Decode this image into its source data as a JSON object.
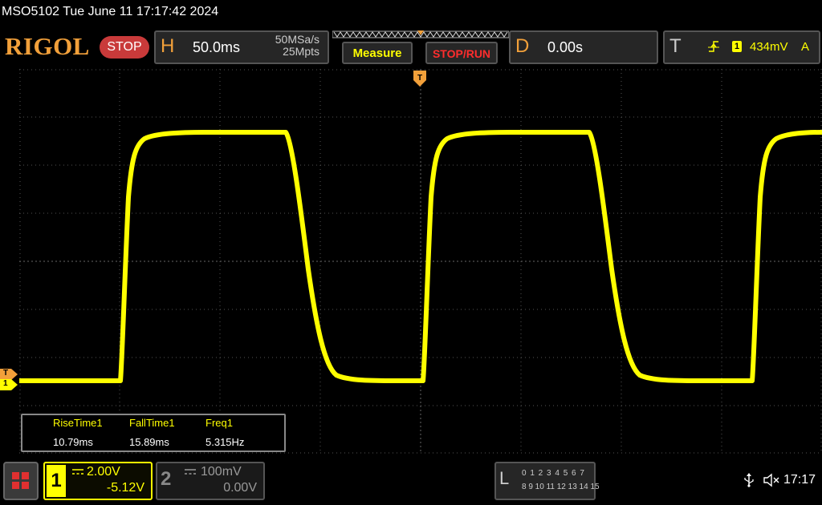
{
  "title": "MSO5102  Tue June 11 17:17:42 2024",
  "brand": {
    "logo_text": "RIGOL",
    "run_state": "STOP"
  },
  "horizontal": {
    "label": "H",
    "timebase": "50.0ms",
    "sample_rate": "50MSa/s",
    "memory_depth": "25Mpts"
  },
  "buttons": {
    "measure": "Measure",
    "stop_run": "STOP/RUN"
  },
  "delay": {
    "label": "D",
    "value": "0.00s"
  },
  "trigger": {
    "label": "T",
    "source": "1",
    "level": "434mV",
    "mode": "A",
    "edge": "rising"
  },
  "markers": {
    "trigger_level": "T",
    "channel1": "1"
  },
  "measurements": [
    {
      "label": "RiseTime1",
      "value": "10.79ms"
    },
    {
      "label": "FallTime1",
      "value": "15.89ms"
    },
    {
      "label": "Freq1",
      "value": "5.315Hz"
    }
  ],
  "channel1": {
    "number": "1",
    "scale": "2.00V",
    "offset": "-5.12V",
    "coupling": "DC",
    "color": "#ffff00"
  },
  "channel2": {
    "number": "2",
    "scale": "100mV",
    "offset": "0.00V",
    "coupling": "DC"
  },
  "logic_analyzer": {
    "label": "L",
    "row1": "0 1 2 3  4 5 6 7",
    "row2": "8 9 10 11  12 13 14 15"
  },
  "status": {
    "time": "17:17",
    "usb_icon": "usb-icon",
    "sound_icon": "sound-muted-icon"
  },
  "colors": {
    "accent": "#f2a03a",
    "trace": "#ffff00",
    "stop": "#c93a3a",
    "grid": "#666666"
  }
}
